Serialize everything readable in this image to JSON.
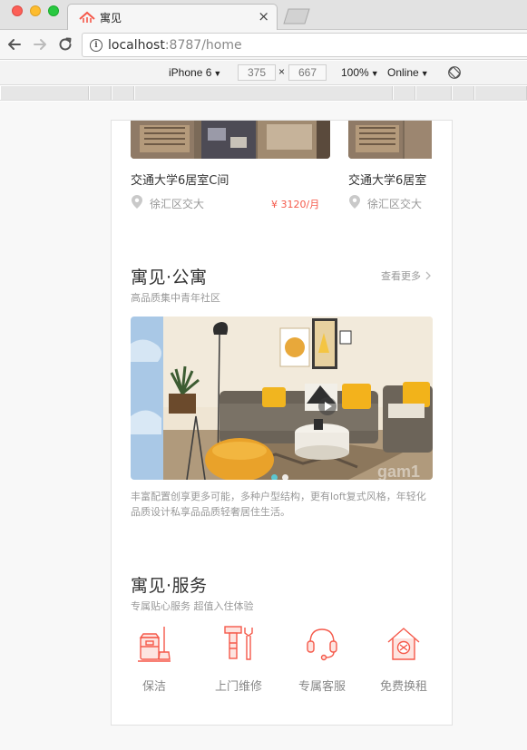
{
  "browser": {
    "tab_title": "寓见",
    "tab_close": "×",
    "url_host": "localhost",
    "url_rest": ":8787/home",
    "info_icon": "i"
  },
  "devtools": {
    "device": "iPhone 6",
    "width": "375",
    "times": "×",
    "height": "667",
    "zoom": "100%",
    "network": "Online"
  },
  "listings": [
    {
      "title": "交通大学6居室C间",
      "location": "徐汇区交大",
      "price": "¥ 3120/月"
    },
    {
      "title": "交通大学6居室",
      "location": "徐汇区交大",
      "price": ""
    }
  ],
  "apartment": {
    "title": "寓见·公寓",
    "subtitle": "高品质集中青年社区",
    "more": "查看更多",
    "description": "丰富配置创享更多可能，多种户型结构，更有loft复式风格，年轻化品质设计私享品品质轻奢居住生活。",
    "watermark": "gam1",
    "carousel_active": 0,
    "carousel_count": 2
  },
  "service": {
    "title": "寓见·服务",
    "subtitle": "专属贴心服务 超值入住体验",
    "items": [
      {
        "label": "保洁",
        "icon": "cleaning-icon"
      },
      {
        "label": "上门维修",
        "icon": "repair-tools-icon"
      },
      {
        "label": "专属客服",
        "icon": "headset-icon"
      },
      {
        "label": "免费换租",
        "icon": "house-swap-icon"
      }
    ]
  },
  "colors": {
    "accent": "#f5594a",
    "text_primary": "#333333",
    "text_secondary": "#999999"
  }
}
